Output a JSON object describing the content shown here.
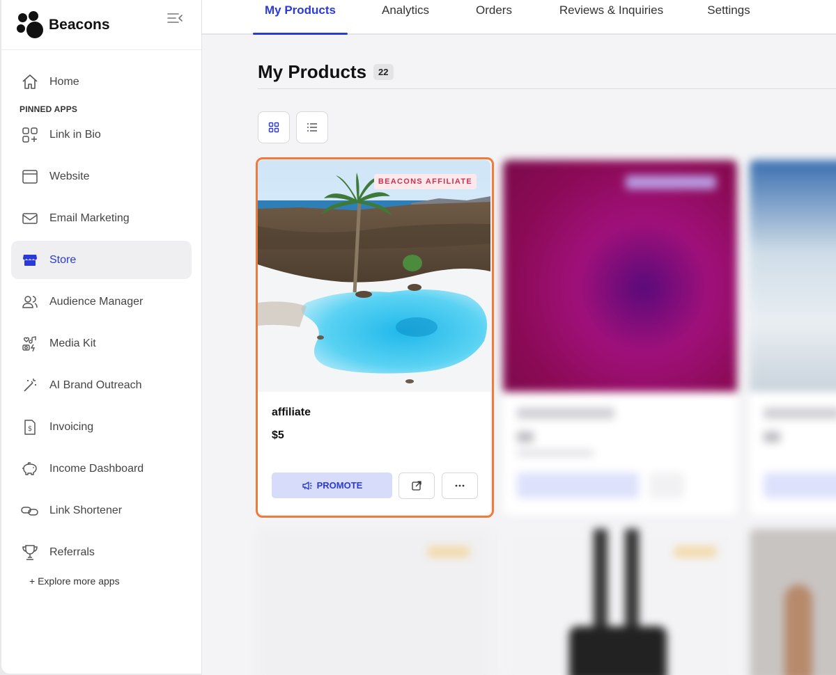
{
  "brand": {
    "name": "Beacons"
  },
  "sidebar": {
    "home": "Home",
    "pinned_label": "PINNED APPS",
    "items": [
      {
        "label": "Link in Bio",
        "icon": "link-in-bio-icon"
      },
      {
        "label": "Website",
        "icon": "browser-window-icon"
      },
      {
        "label": "Email Marketing",
        "icon": "envelope-icon"
      },
      {
        "label": "Store",
        "icon": "store-icon",
        "active": true
      },
      {
        "label": "Audience Manager",
        "icon": "users-icon"
      },
      {
        "label": "Media Kit",
        "icon": "media-kit-icon"
      },
      {
        "label": "AI Brand Outreach",
        "icon": "magic-wand-icon"
      },
      {
        "label": "Invoicing",
        "icon": "invoice-icon"
      },
      {
        "label": "Income Dashboard",
        "icon": "piggy-bank-icon"
      },
      {
        "label": "Link Shortener",
        "icon": "chain-link-icon"
      },
      {
        "label": "Referrals",
        "icon": "trophy-icon"
      }
    ],
    "explore": "+ Explore more apps"
  },
  "tabs": [
    "My Products",
    "Analytics",
    "Orders",
    "Reviews & Inquiries",
    "Settings"
  ],
  "main": {
    "title": "My Products",
    "count": "22"
  },
  "product": {
    "badge": "BEACONS AFFILIATE",
    "name": "affiliate",
    "price": "$5",
    "promote": "PROMOTE"
  },
  "colors": {
    "accent": "#2a3ad8",
    "highlight": "#f07a3c",
    "badge_text": "#c8344f"
  }
}
